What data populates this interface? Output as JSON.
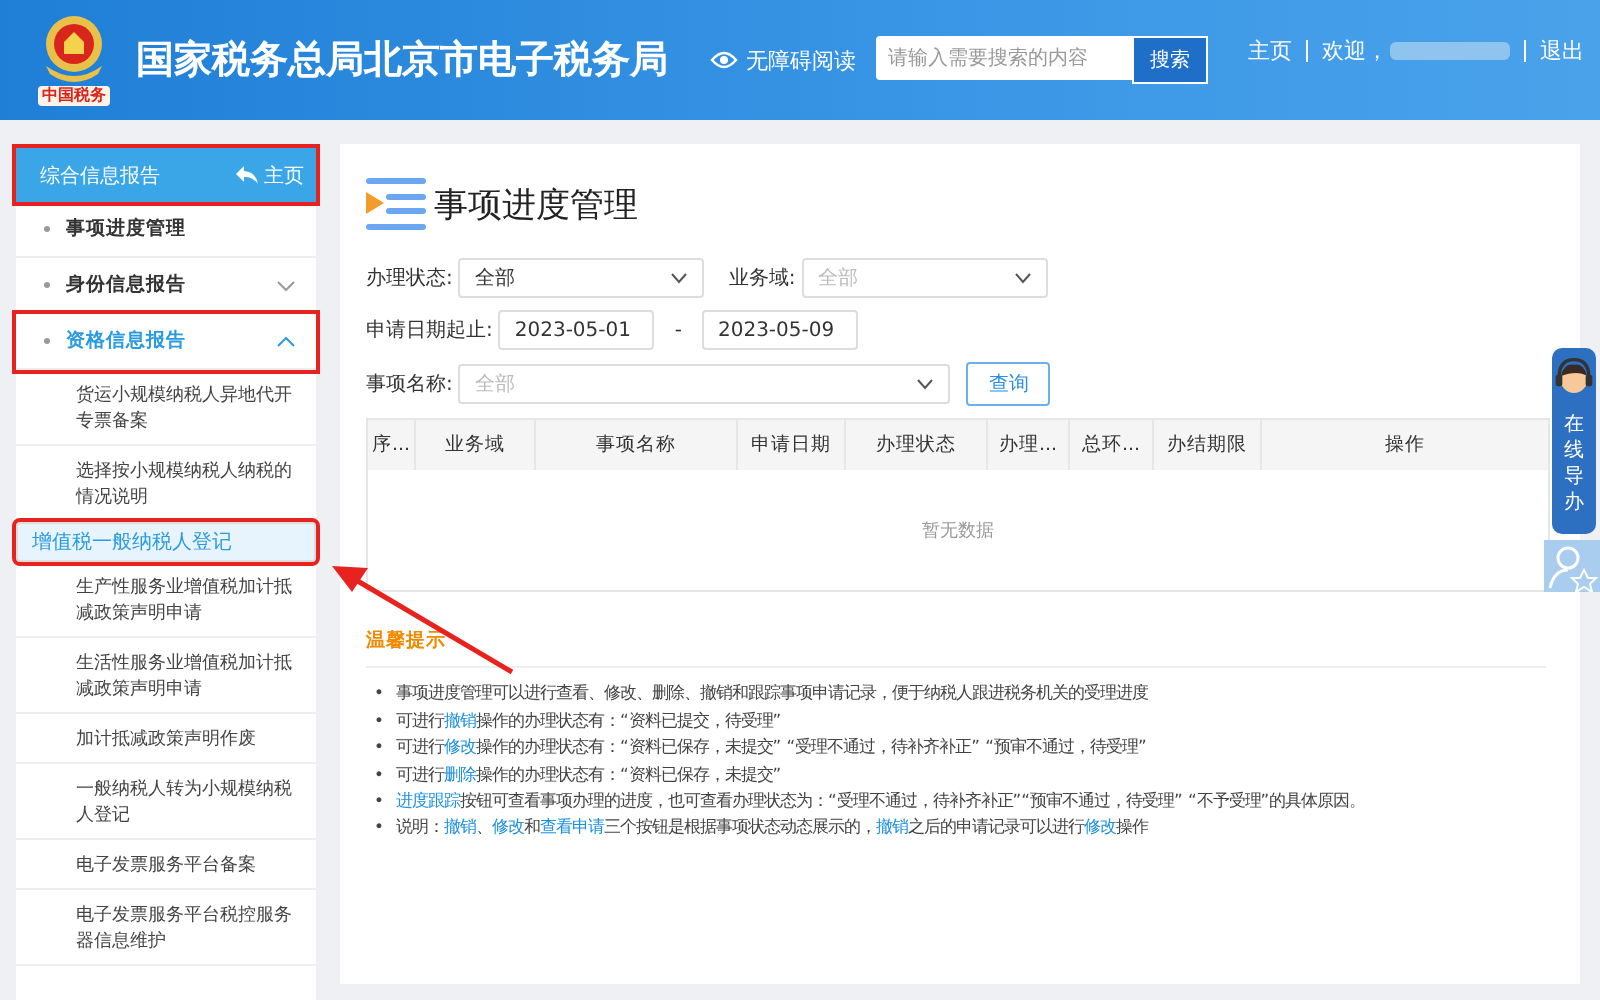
{
  "header": {
    "logo_caption": "中国税务",
    "title": "国家税务总局北京市电子税务局",
    "accessibility": "无障碍阅读",
    "search": {
      "placeholder": "请输入需要搜索的内容",
      "button": "搜索"
    },
    "links": [
      {
        "kind": "link",
        "text": "主页"
      },
      {
        "kind": "user",
        "text": "欢迎，"
      },
      {
        "kind": "link",
        "text": "退出"
      }
    ]
  },
  "sidebar": {
    "title": "综合信息报告",
    "home": "主页",
    "annotated": true,
    "items": [
      {
        "kind": "item",
        "label": "事项进度管理",
        "annotated": false
      },
      {
        "kind": "group",
        "label": "身份信息报告",
        "expanded": false,
        "annotated": false
      },
      {
        "kind": "group",
        "label": "资格信息报告",
        "expanded": true,
        "annotated": true,
        "children": [
          {
            "label": "货运小规模纳税人异地代开专票备案",
            "selected": false,
            "annotated": false
          },
          {
            "label": "选择按小规模纳税人纳税的情况说明",
            "selected": false,
            "annotated": false
          },
          {
            "label": "增值税一般纳税人登记",
            "selected": true,
            "annotated": true
          },
          {
            "label": "生产性服务业增值税加计抵减政策声明申请",
            "selected": false,
            "annotated": false
          },
          {
            "label": "生活性服务业增值税加计抵减政策声明申请",
            "selected": false,
            "annotated": false
          },
          {
            "label": "加计抵减政策声明作废",
            "selected": false,
            "annotated": false
          },
          {
            "label": "一般纳税人转为小规模纳税人登记",
            "selected": false,
            "annotated": false
          },
          {
            "label": "电子发票服务平台备案",
            "selected": false,
            "annotated": false
          },
          {
            "label": "电子发票服务平台税控服务器信息维护",
            "selected": false,
            "annotated": false
          }
        ]
      }
    ]
  },
  "page": {
    "title": "事项进度管理",
    "filters": {
      "status_label": "办理状态:",
      "status_value": "全部",
      "domain_label": "业务域:",
      "domain_placeholder": "全部",
      "date_label": "申请日期起止:",
      "date_from": "2023-05-01",
      "date_sep": "-",
      "date_to": "2023-05-09",
      "name_label": "事项名称:",
      "name_placeholder": "全部",
      "query_button": "查询"
    },
    "table": {
      "columns": [
        "序...",
        "业务域",
        "事项名称",
        "申请日期",
        "办理状态",
        "办理...",
        "总环...",
        "办结期限",
        "操作"
      ],
      "empty": "暂无数据"
    },
    "tips": {
      "title": "温馨提示",
      "marker": "•",
      "notes": [
        [
          {
            "text": "事项进度管理可以进行查看、修改、删除、撤销和跟踪事项申请记录，便于纳税人跟进税务机关的受理进度",
            "link": false
          }
        ],
        [
          {
            "text": "可进行",
            "link": false
          },
          {
            "text": "撤销",
            "link": true
          },
          {
            "text": "操作的办理状态有：“资料已提交，待受理”",
            "link": false
          }
        ],
        [
          {
            "text": "可进行",
            "link": false
          },
          {
            "text": "修改",
            "link": true
          },
          {
            "text": "操作的办理状态有：“资料已保存，未提交”  “受理不通过，待补齐补正”  “预审不通过，待受理”",
            "link": false
          }
        ],
        [
          {
            "text": "可进行",
            "link": false
          },
          {
            "text": "删除",
            "link": true
          },
          {
            "text": "操作的办理状态有：“资料已保存，未提交”",
            "link": false
          }
        ],
        [
          {
            "text": "进度跟踪",
            "link": true
          },
          {
            "text": "按钮可查看事项办理的进度，也可查看办理状态为：“受理不通过，待补齐补正”“预审不通过，待受理” “不予受理”的具体原因。",
            "link": false
          }
        ],
        [
          {
            "text": "说明：",
            "link": false
          },
          {
            "text": "撤销",
            "link": true
          },
          {
            "text": "、",
            "link": false
          },
          {
            "text": "修改",
            "link": true
          },
          {
            "text": "和",
            "link": false
          },
          {
            "text": "查看申请",
            "link": true
          },
          {
            "text": "三个按钮是根据事项状态动态展示的，",
            "link": false
          },
          {
            "text": "撤销",
            "link": true
          },
          {
            "text": "之后的申请记录可以进行",
            "link": false
          },
          {
            "text": "修改",
            "link": true
          },
          {
            "text": "操作",
            "link": false
          }
        ]
      ]
    }
  },
  "guide": {
    "label": "在线导办"
  }
}
